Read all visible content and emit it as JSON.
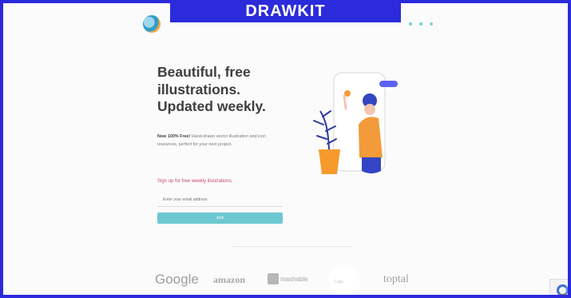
{
  "overlay": {
    "label": "DRAWKIT"
  },
  "hero": {
    "headline": [
      "Beautiful, free",
      "illustrations.",
      "Updated weekly."
    ],
    "desc_bold": "Now 100% Free!",
    "desc_rest": " Hand-drawn vector illustration and icon resources, perfect for your next project.",
    "signup": "Sign up for free weekly illustrations.",
    "email_placeholder": "Enter your email address",
    "join_label": "Join"
  },
  "brands": {
    "google": "Google",
    "amazon": "amazon",
    "mashable": "mashable",
    "circle": "Logo",
    "toptal": "toptal"
  },
  "colors": {
    "frame": "#2b2bdc",
    "accent": "#6cc8d1",
    "signup": "#c84a6e"
  },
  "icons": {
    "logo": "drawkit-logo",
    "recaptcha": "recaptcha-icon"
  }
}
